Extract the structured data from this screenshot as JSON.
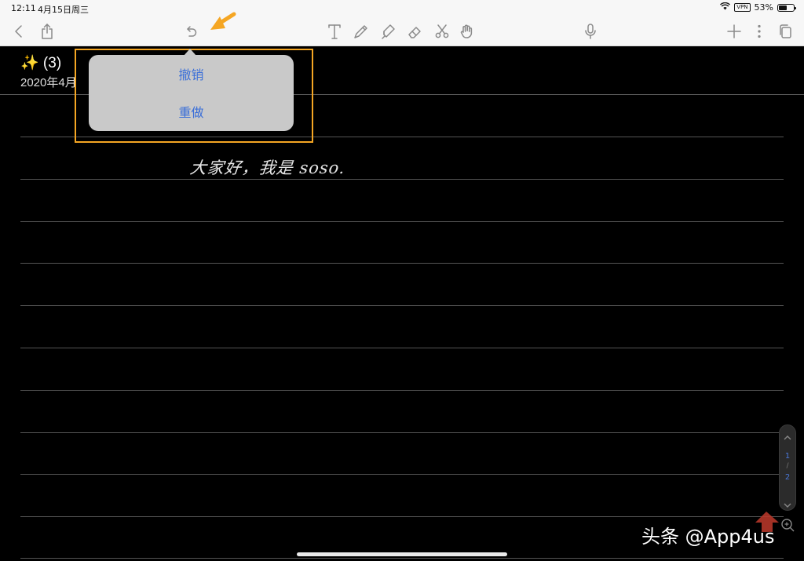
{
  "status_bar": {
    "time": "12:11",
    "date": "4月15日周三",
    "vpn_label": "VPN",
    "battery": "53%",
    "battery_level": 0.53
  },
  "toolbar": {
    "icons": [
      "back-icon",
      "share-icon",
      "undo-icon",
      "text-tool-icon",
      "pen-tool-icon",
      "highlighter-tool-icon",
      "eraser-tool-icon",
      "scissors-tool-icon",
      "hand-tool-icon",
      "microphone-icon",
      "add-icon",
      "more-icon",
      "pages-icon"
    ]
  },
  "note": {
    "title": "✨ (3)",
    "date": "2020年4月"
  },
  "handwriting": "大家好，我是 soso.",
  "popover": {
    "undo_label": "撤销",
    "redo_label": "重做"
  },
  "page_scroller": {
    "current": "1",
    "separator": "/",
    "total": "2"
  },
  "watermark": "头条 @App4us",
  "colors": {
    "accent_blue": "#3b6fd8",
    "highlight_orange": "#f5a623",
    "canvas_bg": "#000000",
    "toolbar_bg": "#f7f7f7"
  }
}
